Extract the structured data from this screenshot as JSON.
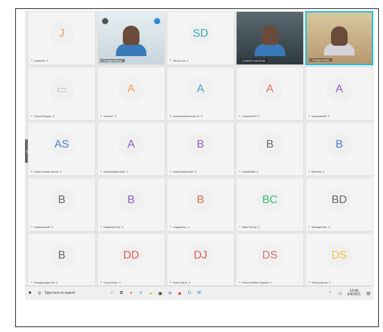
{
  "colors": {
    "avatar_orange": "#f0a050",
    "avatar_teal": "#3aa6b8",
    "avatar_pink": "#e06a6a",
    "avatar_purple": "#8a5ec8",
    "avatar_blue": "#4a7fd0",
    "avatar_grey": "#666666",
    "avatar_green": "#3cb878",
    "avatar_red": "#e85a50",
    "avatar_gold": "#f0c040",
    "highlight": "#20c0d8"
  },
  "participants": [
    {
      "initials": "J",
      "name": "pmitra39",
      "color": "#f0a050"
    },
    {
      "initials": "",
      "name": "Hedgon Barua",
      "video": true
    },
    {
      "initials": "SD",
      "name": "Shubo Da",
      "color": "#3aa6b8"
    },
    {
      "initials": "",
      "name": "KUMAR KAUSHIK",
      "video": true
    },
    {
      "initials": "",
      "name": "Ranjan Sinha",
      "video": true,
      "active": true
    },
    {
      "initials": "",
      "name": "Soumi Sayani",
      "icon": "monitor-icon"
    },
    {
      "initials": "A",
      "name": "anish07",
      "color": "#f0a050"
    },
    {
      "initials": "A",
      "name": "amandeshwar/hoy 11",
      "color": "#3aa6b8"
    },
    {
      "initials": "A",
      "name": "anissa1204",
      "color": "#e06a6a"
    },
    {
      "initials": "A",
      "name": "anuyotas08",
      "color": "#8a5ec8"
    },
    {
      "initials": "AS",
      "name": "anish Kumar sarma",
      "color": "#4a7fd0"
    },
    {
      "initials": "A",
      "name": "ashandapanna02",
      "color": "#8a5ec8"
    },
    {
      "initials": "B",
      "name": "bamandanarad3",
      "color": "#8a5ec8"
    },
    {
      "initials": "B",
      "name": "bandal384",
      "color": "#666666"
    },
    {
      "initials": "B",
      "name": "Bhanda",
      "color": "#4a7fd0"
    },
    {
      "initials": "B",
      "name": "bidahswar80",
      "color": "#666666"
    },
    {
      "initials": "B",
      "name": "bidahsaro110",
      "color": "#8a5ec8"
    },
    {
      "initials": "B",
      "name": "bnaparhoy",
      "color": "#e06a6a"
    },
    {
      "initials": "BC",
      "name": "Bitol Chetry",
      "color": "#3cb878"
    },
    {
      "initials": "BD",
      "name": "Biswajit Das",
      "color": "#666666"
    },
    {
      "initials": "B",
      "name": "bimalpangba 98",
      "color": "#666666"
    },
    {
      "initials": "DD",
      "name": "Deep Deka",
      "color": "#e85a50"
    },
    {
      "initials": "DJ",
      "name": "Deba Jatuk",
      "color": "#e85a50"
    },
    {
      "initials": "DS",
      "name": "Deep Sekhar Saputa",
      "color": "#e06a6a"
    },
    {
      "initials": "DS",
      "name": "Dhiraj sarma",
      "color": "#f0c040"
    }
  ],
  "nav": {
    "prev_label": "‹",
    "next_label": "›"
  },
  "taskbar": {
    "search_placeholder": "Type here to search",
    "time": "10:40",
    "date": "6/4/2021"
  }
}
